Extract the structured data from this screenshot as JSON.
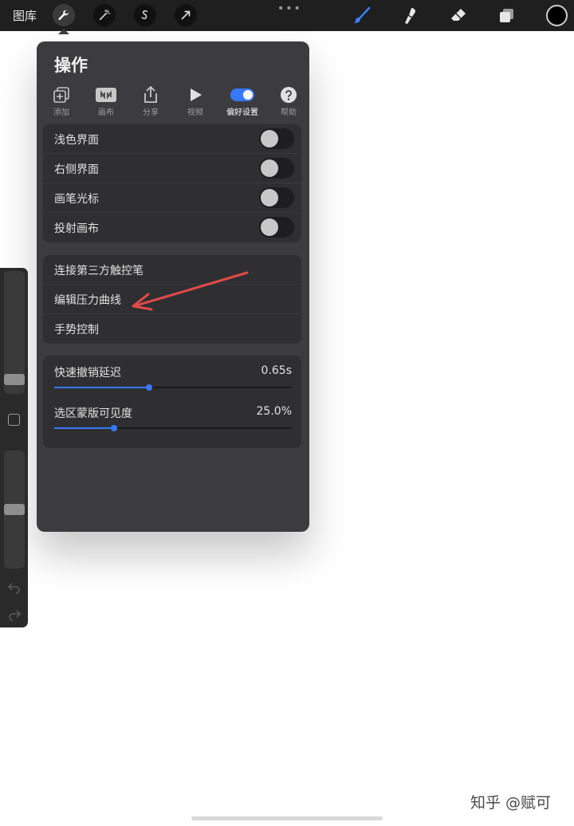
{
  "topbar": {
    "gallery_label": "图库",
    "left_icons": [
      "wrench-icon",
      "magic-wand-icon",
      "selection-s-icon",
      "transform-arrow-icon"
    ],
    "right_tools": [
      "brush-icon",
      "smudge-icon",
      "eraser-icon",
      "layers-icon"
    ],
    "more_dots": "•••",
    "current_color": "#000000"
  },
  "panel": {
    "title": "操作",
    "tabs": [
      {
        "label": "添加",
        "icon": "add-icon"
      },
      {
        "label": "画布",
        "icon": "canvas-icon"
      },
      {
        "label": "分享",
        "icon": "share-icon"
      },
      {
        "label": "视频",
        "icon": "play-icon"
      },
      {
        "label": "偏好设置",
        "icon": "toggle-icon",
        "active": true
      },
      {
        "label": "帮助",
        "icon": "help-icon"
      }
    ],
    "toggles": [
      {
        "label": "浅色界面",
        "on": false
      },
      {
        "label": "右侧界面",
        "on": false
      },
      {
        "label": "画笔光标",
        "on": false
      },
      {
        "label": "投射画布",
        "on": false
      }
    ],
    "links": [
      {
        "label": "连接第三方触控笔"
      },
      {
        "label": "编辑压力曲线"
      },
      {
        "label": "手势控制"
      }
    ],
    "sliders": [
      {
        "label": "快速撤销延迟",
        "value": "0.65s",
        "fraction": 0.4
      },
      {
        "label": "选区蒙版可见度",
        "value": "25.0%",
        "fraction": 0.25
      }
    ]
  },
  "sidebar": {
    "brush_size_level": 0.08,
    "opacity_level": 0.5
  },
  "colors": {
    "accent": "#3778ff",
    "annotation_arrow": "#e14a4a"
  },
  "watermark": "知乎 @赋可"
}
